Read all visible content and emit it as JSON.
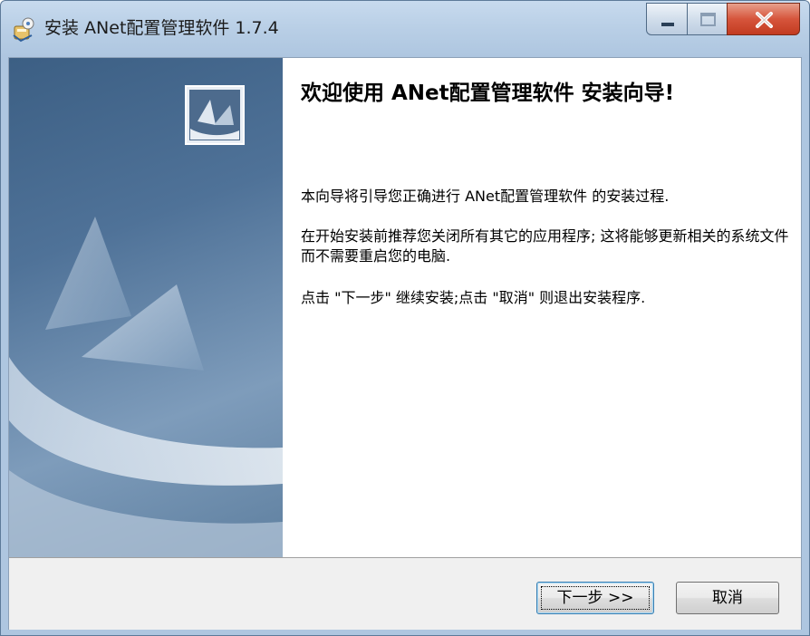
{
  "window": {
    "title": "安装 ANet配置管理软件 1.7.4",
    "minimize_icon": "minimize-icon",
    "maximize_icon": "maximize-icon",
    "close_icon": "close-icon",
    "app_icon": "installer-icon"
  },
  "welcome": {
    "title": "欢迎使用 ANet配置管理软件 安装向导!",
    "paragraph1": "本向导将引导您正确进行 ANet配置管理软件 的安装过程.",
    "paragraph2": "在开始安装前推荐您关闭所有其它的应用程序; 这将能够更新相关的系统文件而不需要重启您的电脑.",
    "paragraph3": "点击 \"下一步\" 继续安装;点击 \"取消\" 则退出安装程序."
  },
  "buttons": {
    "next": "下一步 >>",
    "cancel": "取消"
  },
  "colors": {
    "title_bar": "#b9cfe6",
    "side_panel": "#4f7298",
    "close_button": "#d6553c",
    "footer": "#f0f0f0"
  }
}
